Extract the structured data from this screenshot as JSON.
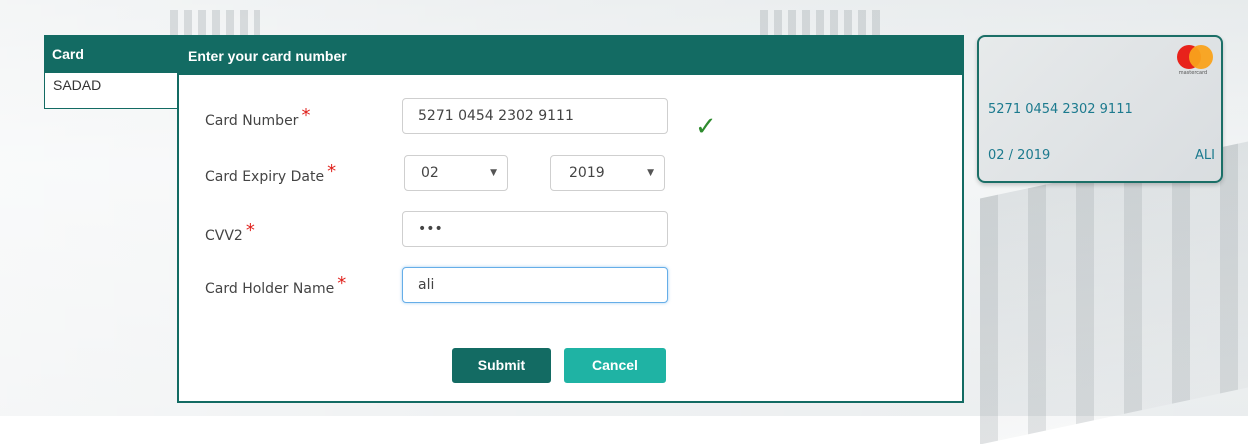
{
  "tabs": {
    "card": "Card",
    "sadad": "SADAD"
  },
  "panel": {
    "title": "Enter your card number"
  },
  "form": {
    "card_number": {
      "label": "Card Number",
      "required_mark": "*",
      "value": "5271 0454 2302 9111",
      "valid_icon": "✓"
    },
    "expiry": {
      "label": "Card Expiry Date",
      "required_mark": "*",
      "month": "02",
      "year": "2019"
    },
    "cvv": {
      "label": "CVV2",
      "required_mark": "*",
      "value": "•••"
    },
    "holder": {
      "label": "Card Holder Name",
      "required_mark": "*",
      "value": "ali"
    }
  },
  "buttons": {
    "submit": "Submit",
    "cancel": "Cancel"
  },
  "card_preview": {
    "brand": "mastercard",
    "number": "5271 0454 2302 9111",
    "expiry": "02 / 2019",
    "name": "ALI"
  },
  "colors": {
    "primary": "#136b63",
    "secondary": "#1fb3a4",
    "required": "#e0211c",
    "valid": "#2e8b2e"
  }
}
